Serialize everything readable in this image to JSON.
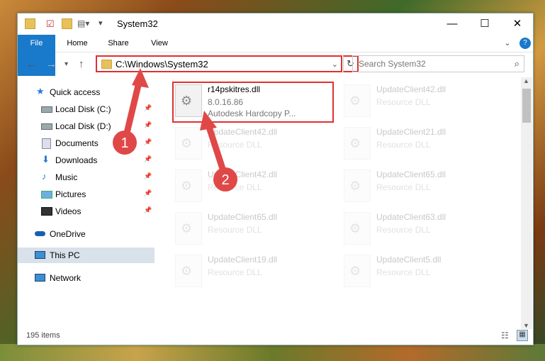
{
  "window": {
    "title": "System32",
    "minimize": "—",
    "maximize": "☐",
    "close": "✕"
  },
  "ribbon": {
    "tabs": [
      "File",
      "Home",
      "Share",
      "View"
    ],
    "expand": "⌄",
    "help": "?"
  },
  "address": {
    "path": "C:\\Windows\\System32",
    "search_placeholder": "Search System32"
  },
  "sidebar": {
    "items": [
      {
        "label": "Quick access",
        "icon": "star-icon"
      },
      {
        "label": "Local Disk (C:)",
        "icon": "drive-icon",
        "pinned": true
      },
      {
        "label": "Local Disk (D:)",
        "icon": "drive-icon",
        "pinned": true
      },
      {
        "label": "Documents",
        "icon": "documents-icon",
        "pinned": true
      },
      {
        "label": "Downloads",
        "icon": "downloads-icon",
        "pinned": true
      },
      {
        "label": "Music",
        "icon": "music-icon",
        "pinned": true
      },
      {
        "label": "Pictures",
        "icon": "pictures-icon",
        "pinned": true
      },
      {
        "label": "Videos",
        "icon": "videos-icon",
        "pinned": true
      },
      {
        "label": "OneDrive",
        "icon": "cloud-icon"
      },
      {
        "label": "This PC",
        "icon": "pc-icon",
        "selected": true
      },
      {
        "label": "Network",
        "icon": "network-icon"
      }
    ]
  },
  "files": [
    {
      "name": "r14pskitres.dll",
      "version": "8.0.16.86",
      "desc": "Autodesk Hardcopy P..."
    },
    {
      "name": "UpdateClient42.dll",
      "desc": "Resource DLL"
    },
    {
      "name": "UpdateClient42.dll",
      "desc": "Resource DLL"
    },
    {
      "name": "UpdateClient21.dll",
      "desc": "Resource DLL"
    },
    {
      "name": "UpdateClient42.dll",
      "desc": "Resource DLL"
    },
    {
      "name": "UpdateClient65.dll",
      "desc": "Resource DLL"
    },
    {
      "name": "UpdateClient65.dll",
      "desc": "Resource DLL"
    },
    {
      "name": "UpdateClient63.dll",
      "desc": "Resource DLL"
    },
    {
      "name": "UpdateClient19.dll",
      "desc": "Resource DLL"
    },
    {
      "name": "UpdateClient5.dll",
      "desc": "Resource DLL"
    }
  ],
  "status": {
    "item_count": "195 items"
  },
  "annotations": {
    "step1": "1",
    "step2": "2"
  },
  "colors": {
    "accent": "#1979ca",
    "highlight": "#e03030"
  }
}
